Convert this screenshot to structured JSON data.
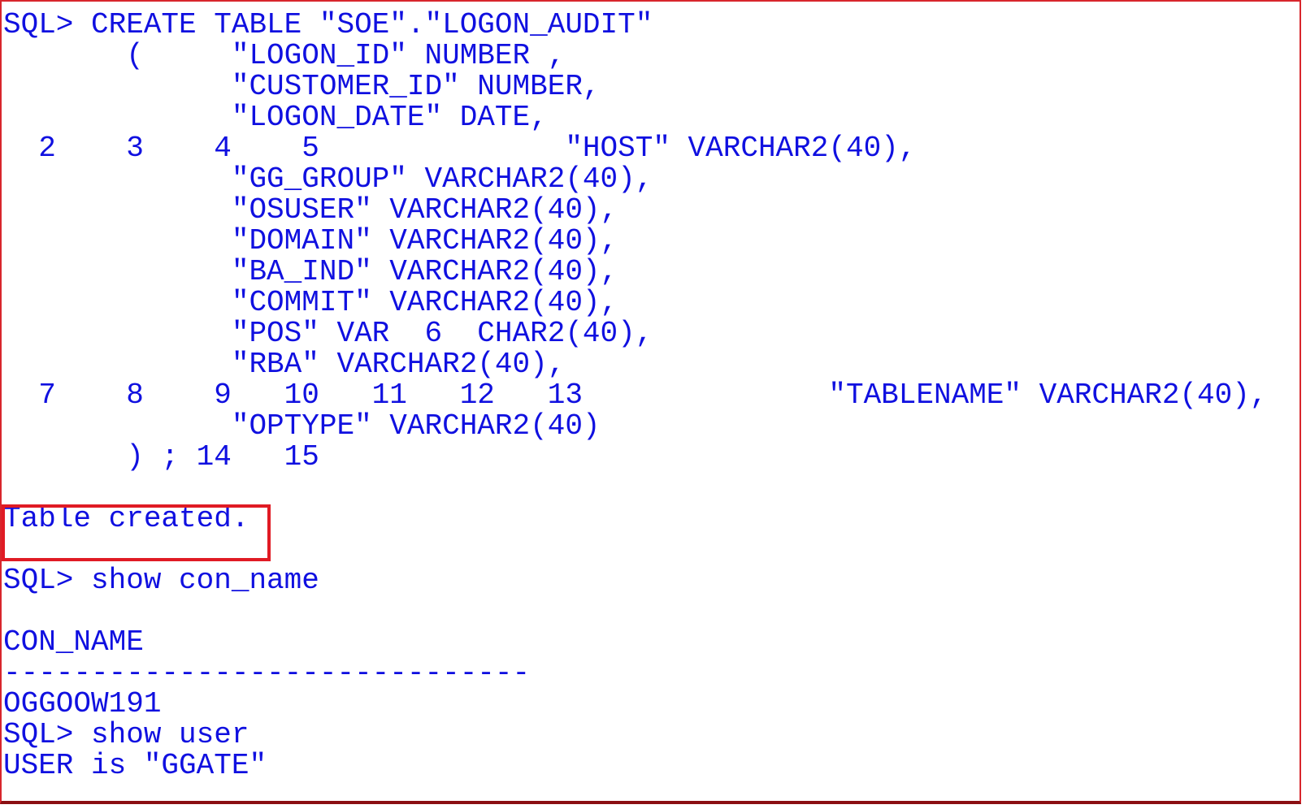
{
  "terminal": {
    "lines": [
      "SQL> CREATE TABLE \"SOE\".\"LOGON_AUDIT\"",
      "       (     \"LOGON_ID\" NUMBER ,",
      "             \"CUSTOMER_ID\" NUMBER,",
      "             \"LOGON_DATE\" DATE,",
      "  2    3    4    5              \"HOST\" VARCHAR2(40),",
      "             \"GG_GROUP\" VARCHAR2(40),",
      "             \"OSUSER\" VARCHAR2(40),",
      "             \"DOMAIN\" VARCHAR2(40),",
      "             \"BA_IND\" VARCHAR2(40),",
      "             \"COMMIT\" VARCHAR2(40),",
      "             \"POS\" VAR  6  CHAR2(40),",
      "             \"RBA\" VARCHAR2(40),",
      "  7    8    9   10   11   12   13              \"TABLENAME\" VARCHAR2(40),",
      "             \"OPTYPE\" VARCHAR2(40)",
      "       ) ; 14   15",
      "",
      "Table created.",
      "",
      "SQL> show con_name",
      "",
      "CON_NAME",
      "------------------------------",
      "OGGOOW191",
      "SQL> show user",
      "USER is \"GGATE\""
    ]
  },
  "colors": {
    "text": "#1010e0",
    "highlight_border": "#e01b24",
    "frame_border": "#d8262c"
  }
}
